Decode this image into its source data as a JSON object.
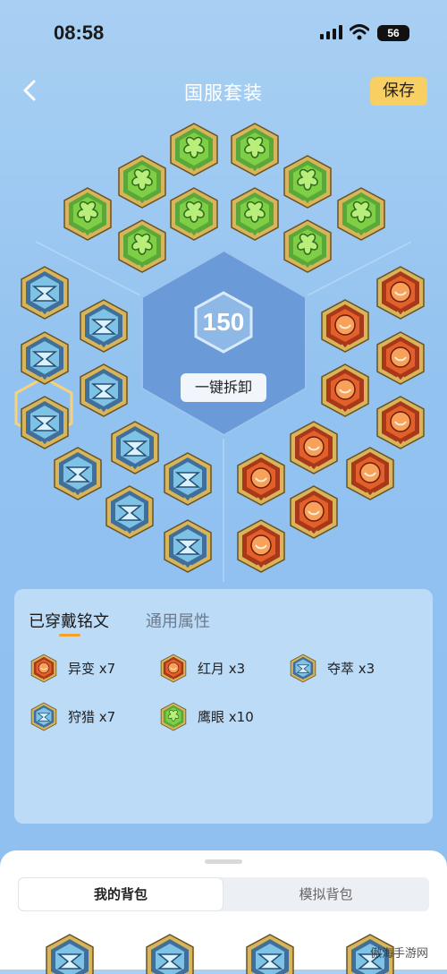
{
  "status_bar": {
    "time": "08:58",
    "battery": "56"
  },
  "header": {
    "title": "国服套装",
    "save_label": "保存"
  },
  "center": {
    "score": "150",
    "unequip_label": "一键拆卸"
  },
  "colors": {
    "green": "#7fcf46",
    "blue": "#7ec3e6",
    "red": "#e3602a",
    "gold": "#d8b45a",
    "accent": "#f8cf63"
  },
  "panel": {
    "tabs": [
      "已穿戴铭文",
      "通用属性"
    ],
    "sets": [
      {
        "icon": "mutation-rune-icon",
        "label": "异变 x7"
      },
      {
        "icon": "red-moon-rune-icon",
        "label": "红月 x3"
      },
      {
        "icon": "plunder-rune-icon",
        "label": "夺萃 x3"
      },
      {
        "icon": "hunt-rune-icon",
        "label": "狩猎 x7"
      },
      {
        "icon": "hawkeye-rune-icon",
        "label": "鹰眼 x10"
      }
    ]
  },
  "bottom_sheet": {
    "tabs": [
      "我的背包",
      "模拟背包"
    ]
  },
  "watermark": "傲海手游网"
}
